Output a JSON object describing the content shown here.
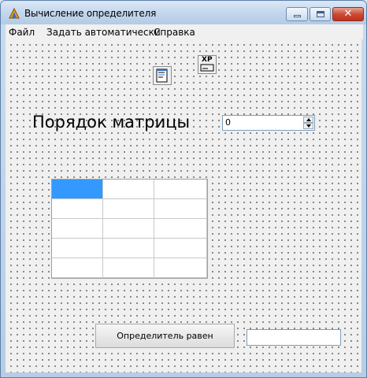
{
  "window": {
    "title": "Вычисление определителя"
  },
  "title_buttons": {
    "close_glyph": "✕"
  },
  "menu": {
    "items": [
      "Файл",
      "Задать автоматически",
      "Справка"
    ]
  },
  "components": {
    "xp_label": "XP"
  },
  "order": {
    "label": "Порядок матрицы",
    "value": "0"
  },
  "matrix": {
    "rows": 5,
    "cols": 3,
    "selected": [
      0,
      0
    ],
    "cells": []
  },
  "determinant": {
    "button_label": "Определитель равен",
    "result": ""
  },
  "colors": {
    "selection": "#3399ff",
    "title_gradient": "#c4d7ec",
    "close_button": "#c0311d"
  }
}
